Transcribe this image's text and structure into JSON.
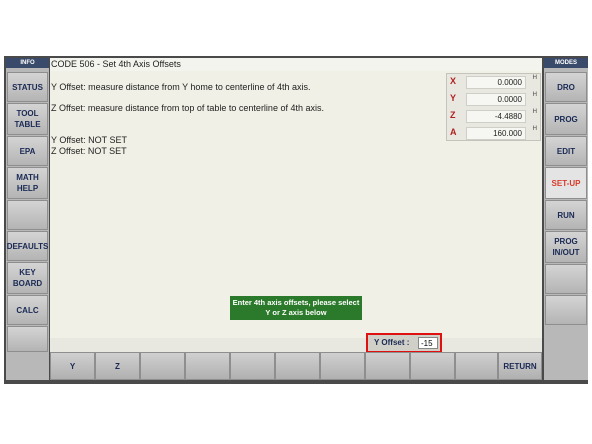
{
  "left_panel": {
    "header": "INFO",
    "buttons": [
      "STATUS",
      "TOOL\nTABLE",
      "EPA",
      "MATH\nHELP",
      "",
      "DEFAULTS",
      "KEY\nBOARD",
      "CALC",
      ""
    ]
  },
  "right_panel": {
    "header": "MODES",
    "buttons": [
      "DRO",
      "PROG",
      "EDIT",
      "SET-UP",
      "RUN",
      "PROG\nIN/OUT",
      "",
      ""
    ]
  },
  "main": {
    "title": "CODE 506 - Set 4th Axis Offsets",
    "line1": "Y Offset: measure distance from Y home to centerline of 4th axis.",
    "line2": "Z Offset: measure distance from top of table to centerline of 4th axis.",
    "status_y": "Y Offset: NOT SET",
    "status_z": "Z Offset: NOT SET"
  },
  "coords": [
    {
      "axis": "X",
      "value": "0.0000",
      "unit": "H"
    },
    {
      "axis": "Y",
      "value": "0.0000",
      "unit": "H"
    },
    {
      "axis": "Z",
      "value": "-4.4880",
      "unit": "H"
    },
    {
      "axis": "A",
      "value": "160.000",
      "unit": "H"
    }
  ],
  "prompt": "Enter 4th axis offsets, please select Y or Z axis below",
  "offset_input": {
    "label": "Y Offset :",
    "value": "-15"
  },
  "bottom_buttons": [
    "Y",
    "Z",
    "",
    "",
    "",
    "",
    "",
    "",
    "",
    "",
    "RETURN"
  ],
  "colors": {
    "active_mode": "#d93a2a",
    "axis_label": "#b02020",
    "prompt_bg": "#2b7a2b",
    "highlight": "#e01010"
  }
}
